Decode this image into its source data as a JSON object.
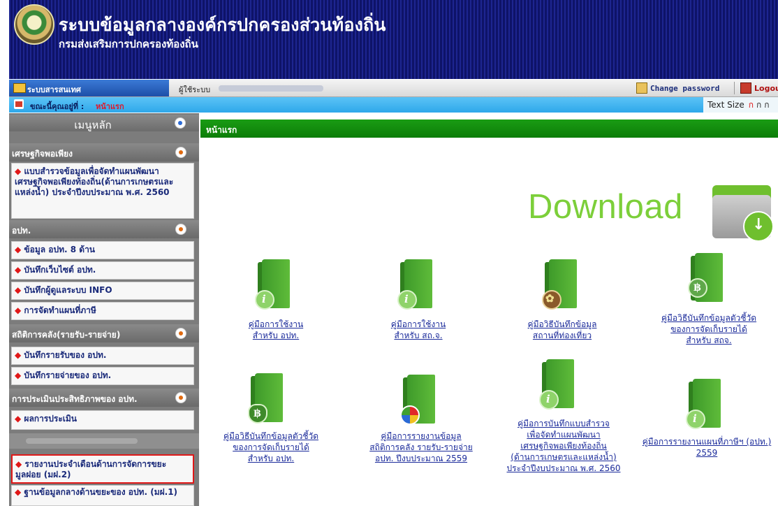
{
  "header": {
    "title": "ระบบข้อมูลกลางองค์กรปกครองส่วนท้องถิ่น",
    "subtitle": "กรมส่งเสริมการปกครองท้องถิ่น"
  },
  "topbar": {
    "system_tab": "ระบบสารสนเทศ",
    "user_label": "ผู้ใช้ระบบ",
    "change_password": "Change password",
    "logout": "Logout"
  },
  "location": {
    "label": "ขณะนี้คุณอยู่ที่ :",
    "current": "หน้าแรก",
    "text_size_label": "Text Size",
    "text_size_a": "ก",
    "text_size_b": "ก",
    "text_size_c": "ก"
  },
  "sidebar": {
    "header": "เมนูหลัก",
    "sections": [
      {
        "title": "เศรษฐกิจพอเพียง",
        "items": [
          "แบบสำรวจข้อมูลเพื่อจัดทำแผนพัฒนาเศรษฐกิจพอเพียงท้องถิ่น(ด้านการเกษตรและแหล่งน้ำ) ประจำปีงบประมาณ พ.ศ. 2560"
        ]
      },
      {
        "title": "อปท.",
        "items": [
          "ข้อมูล อปท. 8 ด้าน",
          "บันทึกเว็บไซต์ อปท.",
          "บันทึกผู้ดูแลระบบ INFO",
          "การจัดทำแผนที่ภาษี"
        ]
      },
      {
        "title": "สถิติการคลัง(รายรับ-รายจ่าย)",
        "items": [
          "บันทึกรายรับของ อปท.",
          "บันทึกรายจ่ายของ อปท."
        ]
      },
      {
        "title": "การประเมินประสิทธิภาพของ อปท.",
        "items": [
          "ผลการประเมิน"
        ]
      }
    ],
    "highlighted_item": "รายงานประจำเดือนด้านการจัดการขยะมูลฝอย (มฝ.2)",
    "last_item": "ฐานข้อมูลกลางด้านขยะของ อปท. (มฝ.1)"
  },
  "content": {
    "heading": "หน้าแรก",
    "download_word": "Download",
    "docs": [
      {
        "line1": "คู่มือการใช้งาน",
        "line2": "สำหรับ อปท.",
        "line3": "",
        "line4": "",
        "line5": "",
        "icon": "info-book-icon"
      },
      {
        "line1": "คู่มือการใช้งาน",
        "line2": "สำหรับ สถ.จ.",
        "line3": "",
        "line4": "",
        "line5": "",
        "icon": "info-book-icon"
      },
      {
        "line1": "คู่มือวิธีบันทึกข้อมูล",
        "line2": "สถานที่ท่องเที่ยว",
        "line3": "",
        "line4": "",
        "line5": "",
        "icon": "palm-book-icon"
      },
      {
        "line1": "คู่มือวิธีบันทึกข้อมูลตัวชี้วัด",
        "line2": "ของการจัดเก็บรายได้",
        "line3": "สำหรับ สถจ.",
        "line4": "",
        "line5": "",
        "icon": "baht-book-icon"
      },
      {
        "line1": "คู่มือวิธีบันทึกข้อมูลตัวชี้วัด",
        "line2": "ของการจัดเก็บรายได้",
        "line3": "สำหรับ อปท.",
        "line4": "",
        "line5": "",
        "icon": "money-bag-book-icon"
      },
      {
        "line1": "คู่มือการรายงานข้อมูล",
        "line2": "สถิติการคลัง รายรับ-รายจ่าย",
        "line3": "อปท. ปีงบประมาณ 2559",
        "line4": "",
        "line5": "",
        "icon": "pie-chart-book-icon"
      },
      {
        "line1": "คู่มือการบันทึกแบบสำรวจ",
        "line2": "เพื่อจัดทำแผนพัฒนา",
        "line3": "เศรษฐกิจพอเพียงท้องถิ่น",
        "line4": "(ด้านการเกษตรและแหล่งน้ำ)",
        "line5": "ประจำปีงบประมาณ พ.ศ. 2560",
        "icon": "info-book-icon"
      },
      {
        "line1": "คู่มือการรายงานแผนที่ภาษีฯ (อปท.)",
        "line2": "2559",
        "line3": "",
        "line4": "",
        "line5": "",
        "icon": "info-book-icon"
      }
    ]
  }
}
